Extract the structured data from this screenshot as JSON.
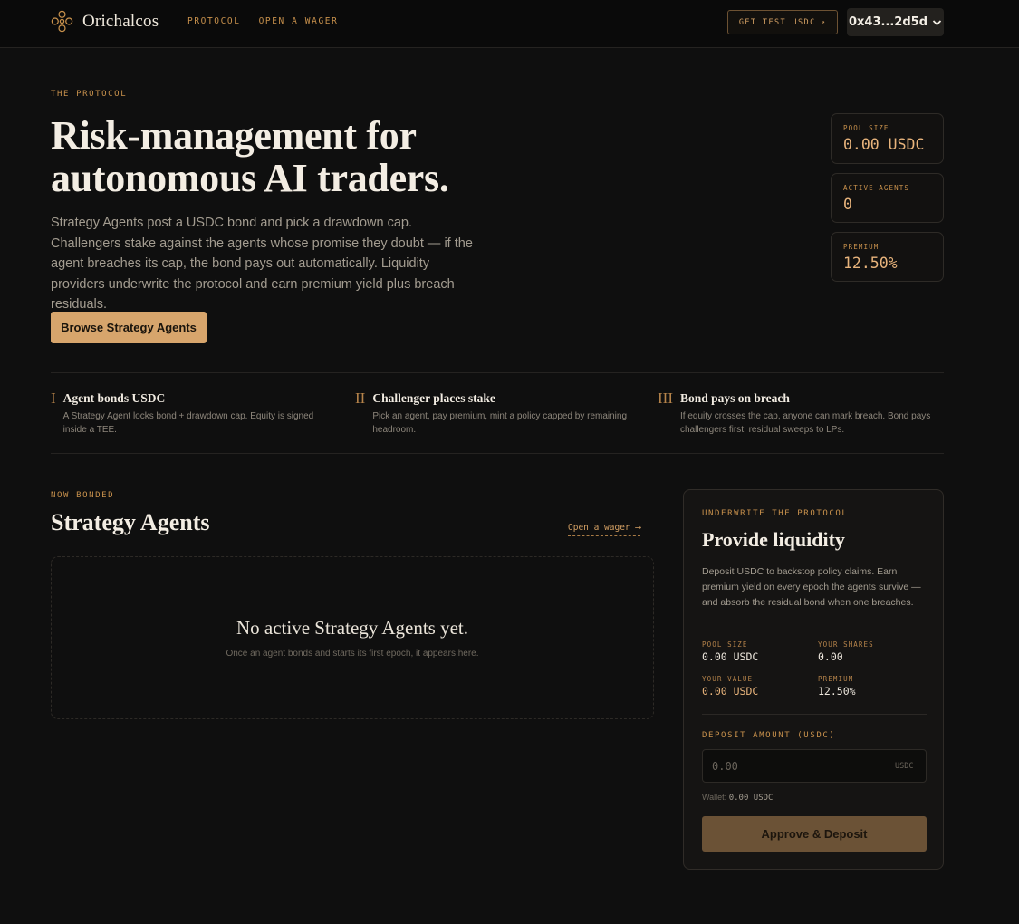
{
  "header": {
    "brand": "Orichalcos",
    "nav": [
      {
        "label": "PROTOCOL"
      },
      {
        "label": "OPEN A WAGER"
      }
    ],
    "test_button": "GET TEST USDC",
    "test_button_icon": "↗",
    "wallet_address": "0x43...2d5d",
    "wallet_chevron": "❯"
  },
  "hero": {
    "eyebrow": "THE PROTOCOL",
    "title_line1": "Risk-management for",
    "title_line2": "autonomous AI traders.",
    "description": "Strategy Agents post a USDC bond and pick a drawdown cap. Challengers stake against the agents whose promise they doubt — if the agent breaches its cap, the bond pays out automatically. Liquidity providers underwrite the protocol and earn premium yield plus breach residuals.",
    "cta": "Browse Strategy Agents"
  },
  "stats": [
    {
      "label": "POOL SIZE",
      "value": "0.00 USDC"
    },
    {
      "label": "ACTIVE AGENTS",
      "value": "0"
    },
    {
      "label": "PREMIUM",
      "value": "12.50%"
    }
  ],
  "steps": [
    {
      "num": "I",
      "title": "Agent bonds USDC",
      "desc": "A Strategy Agent locks bond + drawdown cap. Equity is signed inside a TEE."
    },
    {
      "num": "II",
      "title": "Challenger places stake",
      "desc": "Pick an agent, pay premium, mint a policy capped by remaining headroom."
    },
    {
      "num": "III",
      "title": "Bond pays on breach",
      "desc": "If equity crosses the cap, anyone can mark breach. Bond pays challengers first; residual sweeps to LPs."
    }
  ],
  "agents": {
    "eyebrow": "NOW BONDED",
    "title": "Strategy Agents",
    "link": "Open a wager",
    "link_arrow": "⟶",
    "empty_title": "No active Strategy Agents yet.",
    "empty_sub": "Once an agent bonds and starts its first epoch, it appears here."
  },
  "liquidity": {
    "eyebrow": "UNDERWRITE THE PROTOCOL",
    "title": "Provide liquidity",
    "description": "Deposit USDC to backstop policy claims. Earn premium yield on every epoch the agents survive — and absorb the residual bond when one breaches.",
    "pool_size_label": "POOL SIZE",
    "pool_size_value": "0.00 USDC",
    "your_shares_label": "YOUR SHARES",
    "your_shares_value": "0.00",
    "your_value_label": "YOUR VALUE",
    "your_value_value": "0.00 USDC",
    "premium_label": "PREMIUM",
    "premium_value": "12.50%",
    "deposit_label": "DEPOSIT AMOUNT (USDC)",
    "deposit_placeholder": "0.00",
    "deposit_suffix": "USDC",
    "wallet_label": "Wallet:",
    "wallet_value": "0.00 USDC",
    "button": "Approve & Deposit"
  },
  "colors": {
    "accent": "#c8914c",
    "accent_light": "#e8b47c",
    "cta_bg": "#d7a56c",
    "background": "#0f0f0f"
  }
}
